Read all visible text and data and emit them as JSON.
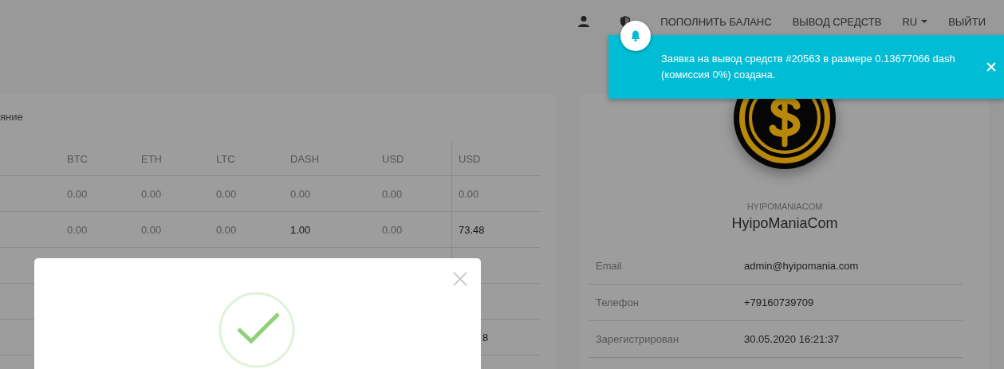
{
  "nav": {
    "items": [
      {
        "label": "ПОПОЛНИТЬ БАЛАНС",
        "kind": "link"
      },
      {
        "label": "ВЫВОД СРЕДСТВ",
        "kind": "link"
      },
      {
        "label": "RU",
        "kind": "dropdown"
      },
      {
        "label": "ВЫЙТИ",
        "kind": "link"
      }
    ]
  },
  "balance_card": {
    "heading": "яние",
    "table": {
      "columns": [
        "BTC",
        "ETH",
        "LTC",
        "DASH",
        "USD",
        "USD"
      ],
      "rows": [
        {
          "cells": [
            {
              "text": "0.00",
              "emphasized": false
            },
            {
              "text": "0.00",
              "emphasized": false
            },
            {
              "text": "0.00",
              "emphasized": false
            },
            {
              "text": "0.00",
              "emphasized": false
            },
            {
              "text": "0.00",
              "emphasized": false
            },
            {
              "text": "0.00",
              "emphasized": false
            }
          ]
        },
        {
          "cells": [
            {
              "text": "0.00",
              "emphasized": false
            },
            {
              "text": "0.00",
              "emphasized": false
            },
            {
              "text": "0.00",
              "emphasized": false
            },
            {
              "text": "1.00",
              "emphasized": true
            },
            {
              "text": "0.00",
              "emphasized": false
            },
            {
              "text": "73.48",
              "emphasized": true
            }
          ]
        },
        {
          "cells": [
            null,
            null,
            null,
            null,
            null,
            null
          ]
        },
        {
          "cells": [
            null,
            null,
            null,
            null,
            null,
            null
          ]
        },
        {
          "cells": [
            null,
            null,
            null,
            null,
            null,
            {
              "text": "8",
              "emphasized": true,
              "kind": "cut"
            }
          ]
        },
        {
          "cells": [
            null,
            null,
            null,
            null,
            null,
            null
          ]
        }
      ]
    }
  },
  "profile_card": {
    "username": "HYIPOMANIACOM",
    "display_name": "HyipoManiaCom",
    "fields": [
      {
        "label": "Email",
        "value": "admin@hyipomania.com"
      },
      {
        "label": "Телефон",
        "value": "+79160739709"
      },
      {
        "label": "Зарегистрирован",
        "value": "30.05.2020 16:21:37"
      }
    ]
  },
  "notification": {
    "message": "Заявка на вывод средств #20563 в размере 0.13677066 dash (комиссия 0%) создана."
  }
}
